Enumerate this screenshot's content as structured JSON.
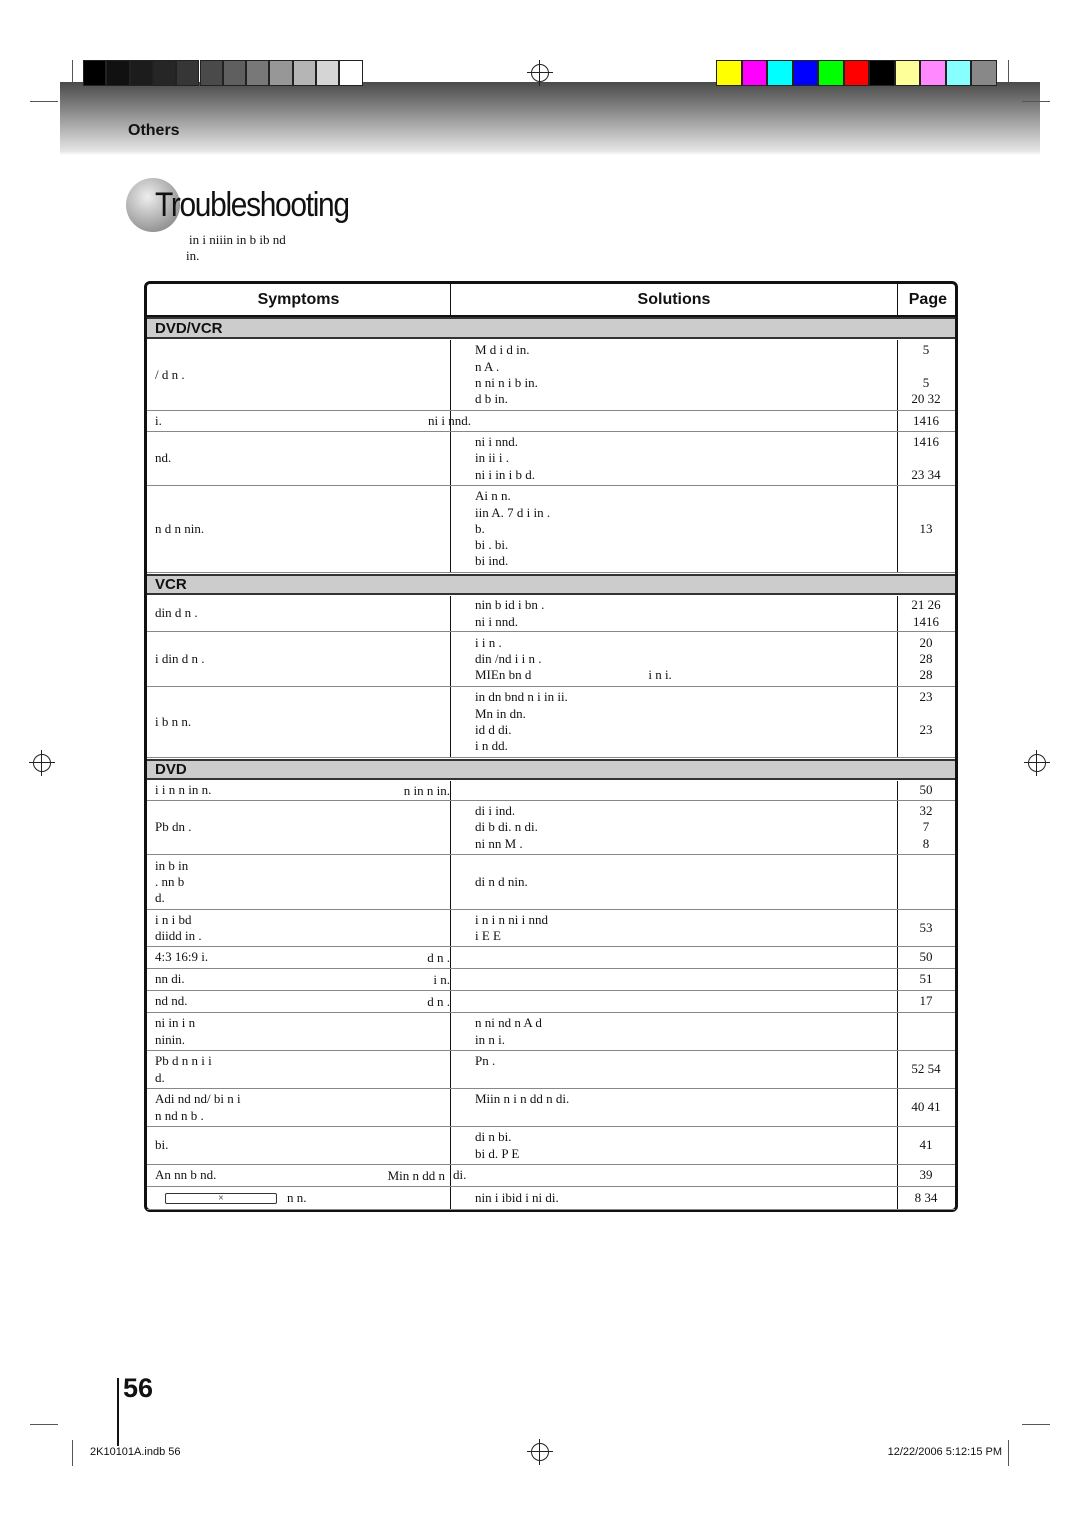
{
  "colors": {
    "grayscale": [
      "#000000",
      "#111111",
      "#1c1c1c",
      "#262626",
      "#363636",
      "#4a4a4a",
      "#5f5f5f",
      "#787878",
      "#979797",
      "#b5b5b5",
      "#d5d5d5",
      "#ffffff"
    ],
    "color_bar": [
      "#ffff00",
      "#ff00ff",
      "#00ffff",
      "#0000ff",
      "#00ff00",
      "#ff0000",
      "#000000",
      "#ffff99",
      "#ff88ff",
      "#88ffff",
      "#888888"
    ]
  },
  "header": {
    "section": "Others"
  },
  "title": "Troubleshooting",
  "intro": [
    "in i niiin in b ib nd",
    "in."
  ],
  "table": {
    "headers": {
      "symptoms": "Symptoms",
      "solutions": "Solutions",
      "page": "Page"
    },
    "sections": [
      {
        "label": "DVD/VCR",
        "rows": [
          {
            "symptom": [
              "/ d n ."
            ],
            "solutions": [
              "M d i d in.",
              "n A .",
              "n ni n i b in.",
              "d b in."
            ],
            "pages": [
              "5",
              "",
              "5",
              "20 32"
            ]
          },
          {
            "symptom": [
              "i."
            ],
            "symptom_right": "ni i nnd.",
            "solutions": [],
            "pages": [
              "1416"
            ]
          },
          {
            "symptom": [
              "nd."
            ],
            "solutions": [
              "ni i nnd.",
              "in ii i .",
              "ni i in i b d."
            ],
            "pages": [
              "1416",
              "",
              "23 34"
            ]
          },
          {
            "symptom": [
              "n d n nin."
            ],
            "solutions": [
              "Ai n n.",
              "iin A. 7 d i in .",
              "b.",
              "bi . bi.",
              "bi ind."
            ],
            "pages": [
              "13"
            ]
          }
        ]
      },
      {
        "label": "VCR",
        "rows": [
          {
            "symptom": [
              "din d n ."
            ],
            "solutions": [
              "nin b id i bn .",
              "ni i nnd."
            ],
            "pages": [
              "21 26",
              "1416"
            ]
          },
          {
            "symptom": [
              "i din d n ."
            ],
            "solutions": [
              "i i n .",
              "din /nd i i n .",
              "MIEn bn d                                    i n i."
            ],
            "pages": [
              "20",
              "28",
              "28"
            ]
          },
          {
            "symptom": [
              "i b n n."
            ],
            "solutions": [
              "in dn bnd n i in ii.",
              "Mn in dn.",
              "id d di.",
              "i n dd."
            ],
            "pages": [
              "23",
              "",
              "23",
              ""
            ]
          }
        ]
      },
      {
        "label": "DVD",
        "rows": [
          {
            "symptom": [
              "i i n n in n."
            ],
            "symptom_right": "n in n in.",
            "solutions": [],
            "pages": [
              "50"
            ]
          },
          {
            "symptom": [
              "Pb dn ."
            ],
            "solutions": [
              "di i ind.",
              "di b di. n di.",
              "ni nn M ."
            ],
            "pages": [
              "32",
              "7",
              "8"
            ]
          },
          {
            "symptom": [
              "in b in",
              ". nn b",
              "d."
            ],
            "solutions": [
              "di n d nin."
            ],
            "pages": []
          },
          {
            "symptom": [
              "i n i bd",
              "diidd in ."
            ],
            "solutions": [
              "i n i n ni i nnd",
              "i E E"
            ],
            "pages": [
              "53"
            ]
          },
          {
            "symptom": [
              "4:3 16:9 i."
            ],
            "symptom_right": "d n .",
            "solutions": [],
            "pages": [
              "50"
            ]
          },
          {
            "symptom": [
              "nn di."
            ],
            "symptom_right": "i n.",
            "solutions": [],
            "pages": [
              "51"
            ]
          },
          {
            "symptom": [
              "nd nd."
            ],
            "symptom_right": "d n .",
            "solutions": [],
            "pages": [
              "17"
            ]
          },
          {
            "symptom": [
              "ni in i n",
              "ninin."
            ],
            "solutions": [
              "n ni nd n A d",
              "in n i."
            ],
            "pages": []
          },
          {
            "symptom": [
              "Pb d n n i i",
              "d."
            ],
            "solutions": [
              "Pn .",
              ""
            ],
            "pages": [
              "52 54"
            ]
          },
          {
            "symptom": [
              "Adi nd nd/ bi n i",
              "n nd n b ."
            ],
            "solutions": [
              "Miin n i n dd n di.",
              ""
            ],
            "pages": [
              "40 41"
            ]
          },
          {
            "symptom": [
              "bi."
            ],
            "solutions": [
              "di n bi.",
              "bi d. P E"
            ],
            "pages": [
              "41"
            ]
          },
          {
            "symptom": [
              "An nn b nd."
            ],
            "symptom_right": "Min n dd n",
            "solutions": [
              "di."
            ],
            "pages": [
              "39"
            ]
          },
          {
            "symptom": [
              "n n."
            ],
            "field_symbol": "×",
            "solutions": [
              "nin i ibid i ni di."
            ],
            "pages": [
              "8 34"
            ]
          }
        ]
      }
    ]
  },
  "page_number": "56",
  "footer": {
    "file": "2K10101A.indb   56",
    "timestamp": "12/22/2006   5:12:15 PM"
  }
}
